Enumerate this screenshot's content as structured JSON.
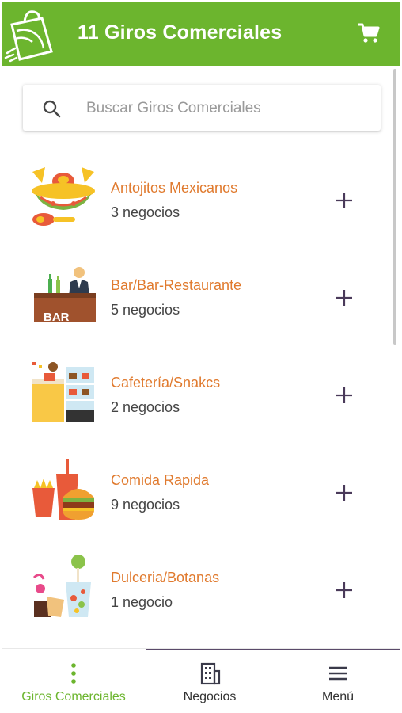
{
  "app_bar": {
    "title": "11 Giros Comerciales",
    "background": "#6cb52e",
    "logo_icon": "shopping-bag-logo",
    "cart_icon": "cart-icon"
  },
  "search": {
    "placeholder": "Buscar Giros Comerciales",
    "value": "",
    "icon": "search-icon"
  },
  "categories": [
    {
      "name": "Antojitos Mexicanos",
      "count": "3 negocios",
      "icon": "sombrero-icon"
    },
    {
      "name": "Bar/Bar-Restaurante",
      "count": "5 negocios",
      "icon": "bar-icon",
      "sign_text": "BAR"
    },
    {
      "name": "Cafetería/Snakcs",
      "count": "2 negocios",
      "icon": "cafeteria-icon"
    },
    {
      "name": "Comida Rapida",
      "count": "9 negocios",
      "icon": "fast-food-icon"
    },
    {
      "name": "Dulceria/Botanas",
      "count": "1 negocio",
      "icon": "candy-icon"
    }
  ],
  "bottom_nav": {
    "active_color": "#6cb52e",
    "tabs": [
      {
        "label": "Giros Comerciales",
        "icon": "dots-vertical-icon",
        "active": true
      },
      {
        "label": "Negocios",
        "icon": "building-icon",
        "active": false
      },
      {
        "label": "Menú",
        "icon": "hamburger-menu-icon",
        "active": false
      }
    ]
  },
  "accent_colors": {
    "category_name": "#e07a2e",
    "plus": "#4a3a5a"
  }
}
